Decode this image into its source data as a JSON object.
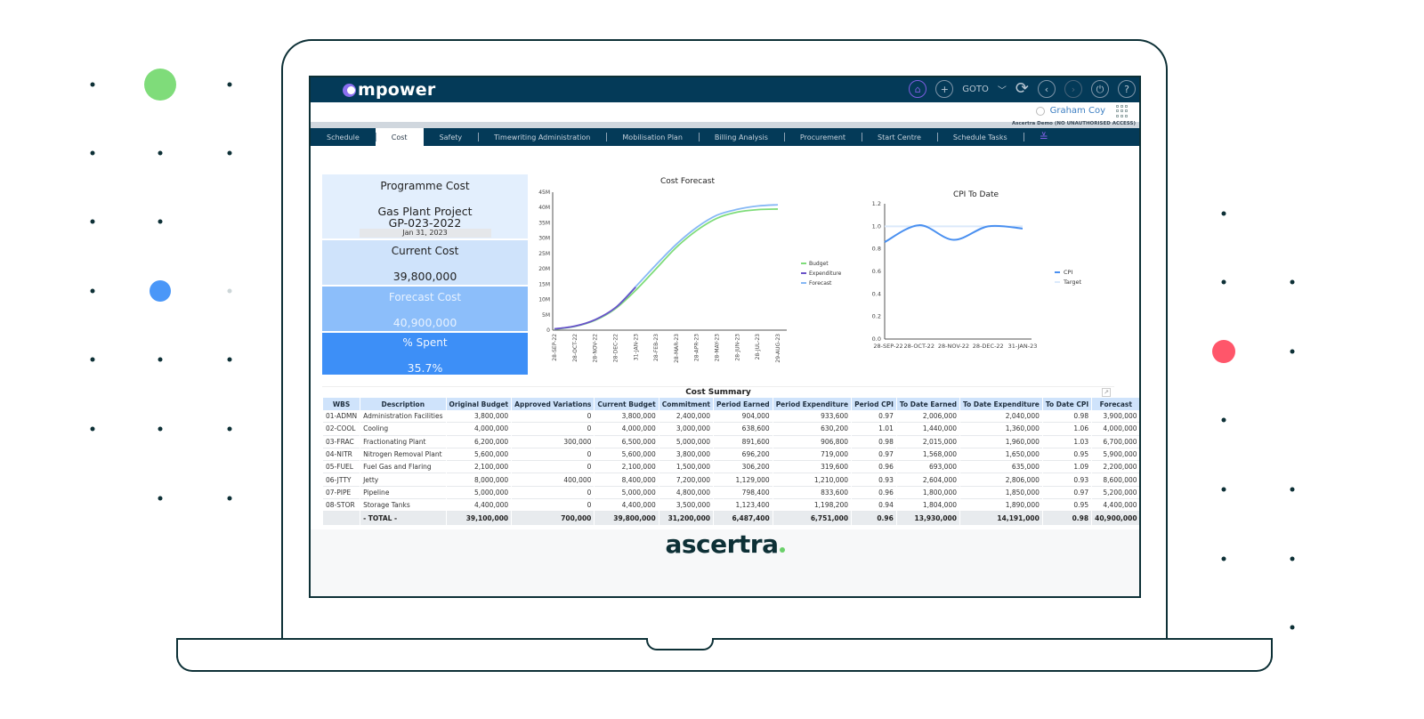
{
  "app": {
    "logo_text": "mpower",
    "top_nav": {
      "home_icon": "home-icon",
      "goto_icon": "crosshair-icon",
      "goto_label": "GOTO",
      "refresh_icon": "refresh-icon",
      "back_icon": "chevron-left-icon",
      "forward_icon": "chevron-right-icon",
      "power_icon": "power-icon",
      "help_icon": "help-icon"
    },
    "user_name": "Graham Coy",
    "environment_notice": "Ascertra Demo (NO UNAUTHORISED ACCESS)",
    "tabs": [
      {
        "label": "Schedule",
        "active": false
      },
      {
        "label": "Cost",
        "active": true
      },
      {
        "label": "Safety",
        "active": false
      },
      {
        "label": "Timewriting Administration",
        "active": false
      },
      {
        "label": "Mobilisation Plan",
        "active": false
      },
      {
        "label": "Billing Analysis",
        "active": false
      },
      {
        "label": "Procurement",
        "active": false
      },
      {
        "label": "Start Centre",
        "active": false
      },
      {
        "label": "Schedule Tasks",
        "active": false
      }
    ],
    "tabs_more_icon": "double-chevron-down-icon"
  },
  "kpis": {
    "title": "Programme Cost",
    "project_name": "Gas Plant Project",
    "project_code": "GP-023-2022",
    "date": "Jan 31, 2023",
    "current_cost_label": "Current Cost",
    "current_cost_value": "39,800,000",
    "forecast_cost_label": "Forecast Cost",
    "forecast_cost_value": "40,900,000",
    "spent_label": "% Spent",
    "spent_value": "35.7%"
  },
  "chart_data": [
    {
      "type": "line",
      "title": "Cost Forecast",
      "xlabel": "",
      "ylabel": "",
      "x": [
        "28-SEP-22",
        "28-OCT-22",
        "28-NOV-22",
        "28-DEC-22",
        "31-JAN-23",
        "28-FEB-23",
        "28-MAR-23",
        "28-APR-23",
        "28-MAY-23",
        "28-JUN-23",
        "28-JUL-23",
        "29-AUG-23"
      ],
      "yticks": [
        "0",
        "5M",
        "10M",
        "15M",
        "20M",
        "25M",
        "30M",
        "35M",
        "40M",
        "45M"
      ],
      "ylim": [
        0,
        45000000
      ],
      "legend": "right",
      "series": [
        {
          "name": "Budget",
          "color": "#7fdc7a",
          "values": [
            0.3,
            1.2,
            3.2,
            7.0,
            13.0,
            20.0,
            27.0,
            32.5,
            36.5,
            38.5,
            39.3,
            39.5
          ]
        },
        {
          "name": "Expenditure",
          "color": "#6a52c8",
          "values": [
            0.4,
            1.3,
            3.4,
            7.3,
            14.0,
            null,
            null,
            null,
            null,
            null,
            null,
            null
          ]
        },
        {
          "name": "Forecast",
          "color": "#86b8f5",
          "values": [
            0.4,
            1.3,
            3.4,
            7.3,
            14.2,
            21.3,
            28.0,
            33.5,
            37.5,
            39.4,
            40.5,
            40.9
          ]
        }
      ],
      "units": "millions"
    },
    {
      "type": "line",
      "title": "CPI To Date",
      "x": [
        "28-SEP-22",
        "28-OCT-22",
        "28-NOV-22",
        "28-DEC-22",
        "31-JAN-23"
      ],
      "yticks": [
        "0.0",
        "0.2",
        "0.4",
        "0.6",
        "0.8",
        "1.0",
        "1.2"
      ],
      "ylim": [
        0,
        1.2
      ],
      "legend": "right",
      "series": [
        {
          "name": "CPI",
          "color": "#4a90f0",
          "values": [
            0.86,
            1.01,
            0.88,
            1.0,
            0.98
          ]
        },
        {
          "name": "Target",
          "color": "#dbe9fb",
          "values": [
            1.0,
            1.0,
            1.0,
            1.0,
            1.0
          ]
        }
      ]
    }
  ],
  "summary": {
    "title": "Cost Summary",
    "popout_icon": "external-link-icon",
    "columns": [
      "WBS",
      "Description",
      "Original Budget",
      "Approved Variations",
      "Current Budget",
      "Commitment",
      "Period Earned",
      "Period Expenditure",
      "Period CPI",
      "To Date Earned",
      "To Date Expenditure",
      "To Date CPI",
      "Forecast"
    ],
    "rows": [
      [
        "01-ADMN",
        "Administration Facilities",
        "3,800,000",
        "0",
        "3,800,000",
        "2,400,000",
        "904,000",
        "933,600",
        "0.97",
        "2,006,000",
        "2,040,000",
        "0.98",
        "3,900,000"
      ],
      [
        "02-COOL",
        "Cooling",
        "4,000,000",
        "0",
        "4,000,000",
        "3,000,000",
        "638,600",
        "630,200",
        "1.01",
        "1,440,000",
        "1,360,000",
        "1.06",
        "4,000,000"
      ],
      [
        "03-FRAC",
        "Fractionating Plant",
        "6,200,000",
        "300,000",
        "6,500,000",
        "5,000,000",
        "891,600",
        "906,800",
        "0.98",
        "2,015,000",
        "1,960,000",
        "1.03",
        "6,700,000"
      ],
      [
        "04-NITR",
        "Nitrogen Removal Plant",
        "5,600,000",
        "0",
        "5,600,000",
        "3,800,000",
        "696,200",
        "719,000",
        "0.97",
        "1,568,000",
        "1,650,000",
        "0.95",
        "5,900,000"
      ],
      [
        "05-FUEL",
        "Fuel Gas and Flaring",
        "2,100,000",
        "0",
        "2,100,000",
        "1,500,000",
        "306,200",
        "319,600",
        "0.96",
        "693,000",
        "635,000",
        "1.09",
        "2,200,000"
      ],
      [
        "06-JTTY",
        "Jetty",
        "8,000,000",
        "400,000",
        "8,400,000",
        "7,200,000",
        "1,129,000",
        "1,210,000",
        "0.93",
        "2,604,000",
        "2,806,000",
        "0.93",
        "8,600,000"
      ],
      [
        "07-PIPE",
        "Pipeline",
        "5,000,000",
        "0",
        "5,000,000",
        "4,800,000",
        "798,400",
        "833,600",
        "0.96",
        "1,800,000",
        "1,850,000",
        "0.97",
        "5,200,000"
      ],
      [
        "08-STOR",
        "Storage Tanks",
        "4,400,000",
        "0",
        "4,400,000",
        "3,500,000",
        "1,123,400",
        "1,198,200",
        "0.94",
        "1,804,000",
        "1,890,000",
        "0.95",
        "4,400,000"
      ]
    ],
    "total": [
      "",
      "- TOTAL -",
      "39,100,000",
      "700,000",
      "39,800,000",
      "31,200,000",
      "6,487,400",
      "6,751,000",
      "0.96",
      "13,930,000",
      "14,191,000",
      "0.98",
      "40,900,000"
    ]
  },
  "footer": {
    "brand": "ascertra"
  },
  "decor": {
    "colors": {
      "green": "#7fdc7a",
      "blue": "#4a97f8",
      "red": "#ff566a",
      "outline": "#0d3036"
    }
  }
}
